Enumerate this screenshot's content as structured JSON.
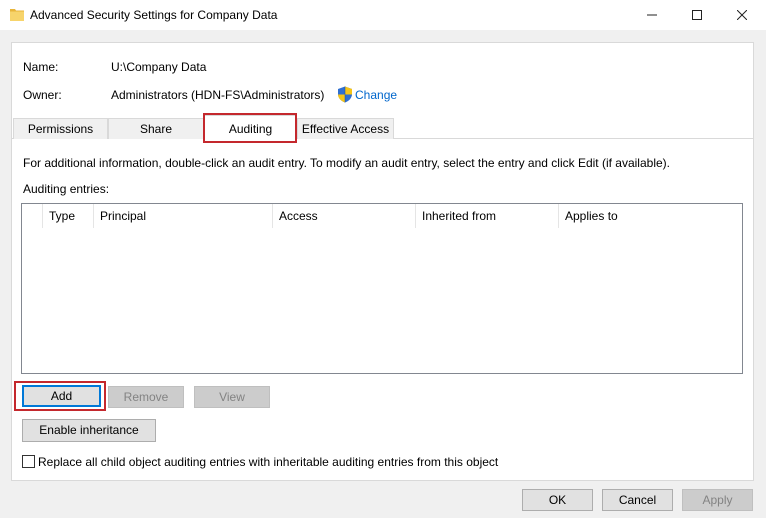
{
  "window": {
    "title": "Advanced Security Settings for Company Data",
    "controls": {
      "minimize": "minimize",
      "maximize": "maximize",
      "close": "close"
    }
  },
  "object": {
    "name_label": "Name:",
    "name_value": "U:\\Company Data",
    "owner_label": "Owner:",
    "owner_value": "Administrators (HDN-FS\\Administrators)",
    "change_link": "Change"
  },
  "tabs": [
    {
      "label": "Permissions",
      "selected": false
    },
    {
      "label": "Share",
      "selected": false
    },
    {
      "label": "Auditing",
      "selected": true
    },
    {
      "label": "Effective Access",
      "selected": false
    }
  ],
  "auditing": {
    "info_text": "For additional information, double-click an audit entry. To modify an audit entry, select the entry and click Edit (if available).",
    "entries_label": "Auditing entries:",
    "columns": [
      "",
      "Type",
      "Principal",
      "Access",
      "Inherited from",
      "Applies to"
    ],
    "rows": []
  },
  "buttons": {
    "add": "Add",
    "remove": "Remove",
    "view": "View",
    "enable_inheritance": "Enable inheritance"
  },
  "replace_checkbox": {
    "label": "Replace all child object auditing entries with inheritable auditing entries from this object",
    "checked": false
  },
  "footer": {
    "ok": "OK",
    "cancel": "Cancel",
    "apply": "Apply"
  },
  "colors": {
    "highlight": "#c4282d",
    "link": "#0066cc",
    "focus": "#0078d7"
  }
}
